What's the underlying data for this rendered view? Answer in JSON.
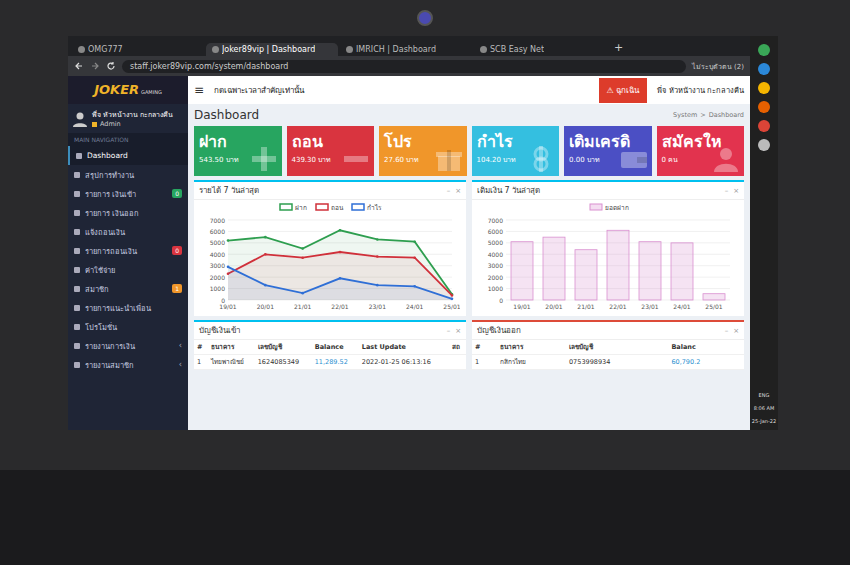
{
  "browser": {
    "tabs": [
      {
        "label": "OMG777",
        "selected": false
      },
      {
        "label": "Joker89vip | Dashboard",
        "selected": true
      },
      {
        "label": "IMRICH | Dashboard",
        "selected": false
      },
      {
        "label": "SCB Easy Net",
        "selected": false
      }
    ],
    "new_tab": "+",
    "address": "staff.joker89vip.com/system/dashboard",
    "profile": "ไม่ระบุตัวตน (2)"
  },
  "app": {
    "logo": {
      "main": "JOKER",
      "sub": "GAMING"
    },
    "user": {
      "name": "พี่จ หัวหน้างาน กะกลางคืน",
      "role": "Admin"
    },
    "menu_toggle": "≡",
    "notice": "กดเฉพาะเวลาสำคัญเท่านั้น",
    "emergency_button": "⚠ ฉุกเฉิน",
    "header_user": "พี่จ หัวหน้างาน กะกลางคืน"
  },
  "sidebar": {
    "heading": "MAIN NAVIGATION",
    "items": [
      {
        "label": "Dashboard",
        "selected": true,
        "badge": null,
        "badge_color": null,
        "arrow": null
      },
      {
        "label": "สรุปการทำงาน",
        "selected": false,
        "badge": null,
        "badge_color": null,
        "arrow": null
      },
      {
        "label": "รายการ เงินเข้า",
        "selected": false,
        "badge": "0",
        "badge_color": "#27a560",
        "arrow": null
      },
      {
        "label": "รายการ เงินออก",
        "selected": false,
        "badge": null,
        "badge_color": null,
        "arrow": null
      },
      {
        "label": "แจ้งถอนเงิน",
        "selected": false,
        "badge": null,
        "badge_color": null,
        "arrow": null
      },
      {
        "label": "รายการถอนเงิน",
        "selected": false,
        "badge": "0",
        "badge_color": "#d9343f",
        "arrow": null
      },
      {
        "label": "ค่าใช้จ่าย",
        "selected": false,
        "badge": null,
        "badge_color": null,
        "arrow": null
      },
      {
        "label": "สมาชิก",
        "selected": false,
        "badge": "1",
        "badge_color": "#f0962a",
        "arrow": null
      },
      {
        "label": "รายการแนะนำเพื่อน",
        "selected": false,
        "badge": null,
        "badge_color": null,
        "arrow": null
      },
      {
        "label": "โปรโมชั่น",
        "selected": false,
        "badge": null,
        "badge_color": null,
        "arrow": null
      },
      {
        "label": "รายงานการเงิน",
        "selected": false,
        "badge": null,
        "badge_color": null,
        "arrow": "‹"
      },
      {
        "label": "รายงานสมาชิก",
        "selected": false,
        "badge": null,
        "badge_color": null,
        "arrow": "‹"
      }
    ]
  },
  "page": {
    "title": "Dashboard",
    "breadcrumb": [
      "System",
      "Dashboard"
    ],
    "breadcrumb_sep": ">"
  },
  "cards": [
    {
      "title": "ฝาก",
      "value": "543.50 บาท",
      "color": "#27a560",
      "icon": "plus"
    },
    {
      "title": "ถอน",
      "value": "439.30 บาท",
      "color": "#d9343f",
      "icon": "minus"
    },
    {
      "title": "โปร",
      "value": "27.60 บาท",
      "color": "#f0962a",
      "icon": "gift"
    },
    {
      "title": "กำไร",
      "value": "104.20 บาท",
      "color": "#34bfe0",
      "icon": "dollar"
    },
    {
      "title": "เติมเครดิ",
      "value": "0.00 บาท",
      "color": "#4b4fc4",
      "icon": "wallet"
    },
    {
      "title": "สมัครให",
      "value": "0 คน",
      "color": "#e2334e",
      "icon": "user"
    }
  ],
  "panel_controls": [
    "–",
    "×"
  ],
  "revenue_chart": {
    "title": "รายได้ 7 วันล่าสุด",
    "y_ticks": [
      "0",
      "1000",
      "2000",
      "3000",
      "4000",
      "5000",
      "6000",
      "7000"
    ],
    "x_labels": [
      "19/01",
      "20/01",
      "21/01",
      "22/01",
      "23/01",
      "24/01",
      "25/01"
    ],
    "series": [
      {
        "name": "ฝาก",
        "color": "#2e9e4f",
        "values": [
          5200,
          5500,
          4500,
          6100,
          5300,
          5100,
          500
        ]
      },
      {
        "name": "ถอน",
        "color": "#d0303a",
        "values": [
          2300,
          4000,
          3700,
          4200,
          3800,
          3700,
          400
        ]
      },
      {
        "name": "กำไร",
        "color": "#2f6fd6",
        "values": [
          2900,
          1300,
          600,
          1900,
          1300,
          1200,
          100
        ]
      }
    ]
  },
  "topup_chart": {
    "title": "เติมเงิน 7 วันล่าสุด",
    "y_ticks": [
      "0",
      "1000",
      "2000",
      "3000",
      "4000",
      "5000",
      "6000",
      "7000"
    ],
    "x_labels": [
      "19/01",
      "20/01",
      "21/01",
      "22/01",
      "23/01",
      "24/01",
      "25/01"
    ],
    "series": [
      {
        "name": "ยอดฝาก",
        "color": "#d98fd0",
        "values": [
          5100,
          5500,
          4400,
          6100,
          5100,
          5000,
          550
        ]
      }
    ]
  },
  "tables": [
    {
      "title": "บัญชีเงินเข้า",
      "columns": [
        "#",
        "ธนาคาร",
        "เลขบัญชี",
        "Balance",
        "Last Update",
        "สถ"
      ],
      "rows": [
        [
          "1",
          "ไทยพาณิชย์",
          "1624085349",
          "11,289.52",
          "2022-01-25 06:13:16",
          ""
        ]
      ]
    },
    {
      "title": "บัญชีเงินออก",
      "columns": [
        "#",
        "ธนาคาร",
        "เลขบัญชี",
        "Balanc"
      ],
      "rows": [
        [
          "1",
          "กสิกรไทย",
          "0753998934",
          "60,790.2"
        ]
      ]
    }
  ],
  "taskbar": {
    "language": "ENG",
    "time": "8:06 AM",
    "date": "25-Jan-22"
  }
}
